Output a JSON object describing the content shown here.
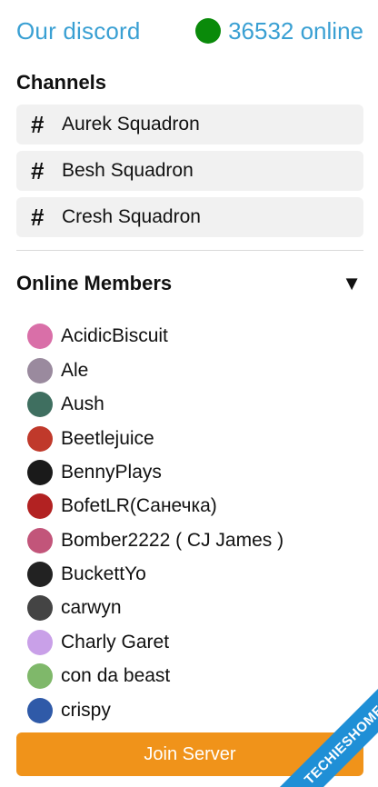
{
  "header": {
    "title": "Our discord",
    "online_count": "36532 online",
    "status_color": "#0a8a0a",
    "accent_color": "#3aa0d3"
  },
  "channels": {
    "title": "Channels",
    "items": [
      {
        "icon": "#",
        "label": "Aurek Squadron"
      },
      {
        "icon": "#",
        "label": "Besh Squadron"
      },
      {
        "icon": "#",
        "label": "Cresh Squadron"
      }
    ]
  },
  "members": {
    "title": "Online Members",
    "toggle_icon": "▼",
    "items": [
      {
        "name": "AcidicBiscuit",
        "avatar_color": "#d96fa8"
      },
      {
        "name": "Ale",
        "avatar_color": "#9a8a9e"
      },
      {
        "name": "Aush",
        "avatar_color": "#3f6f60"
      },
      {
        "name": "Beetlejuice",
        "avatar_color": "#c0392b"
      },
      {
        "name": "BennyPlays",
        "avatar_color": "#1a1a1a"
      },
      {
        "name": "BofetLR(Санечка)",
        "avatar_color": "#b22222"
      },
      {
        "name": "Bomber2222 ( CJ James )",
        "avatar_color": "#c2557a"
      },
      {
        "name": "BuckettYo",
        "avatar_color": "#222222"
      },
      {
        "name": "carwyn",
        "avatar_color": "#444444"
      },
      {
        "name": "Charly Garet",
        "avatar_color": "#c9a0e8"
      },
      {
        "name": "con da beast",
        "avatar_color": "#7fb86a"
      },
      {
        "name": "crispy",
        "avatar_color": "#2f5aa8"
      }
    ]
  },
  "join_button": {
    "label": "Join Server",
    "color": "#f0931a"
  },
  "watermark": {
    "text": "TECHIESHOME.COM",
    "color": "#1f8fd6"
  }
}
